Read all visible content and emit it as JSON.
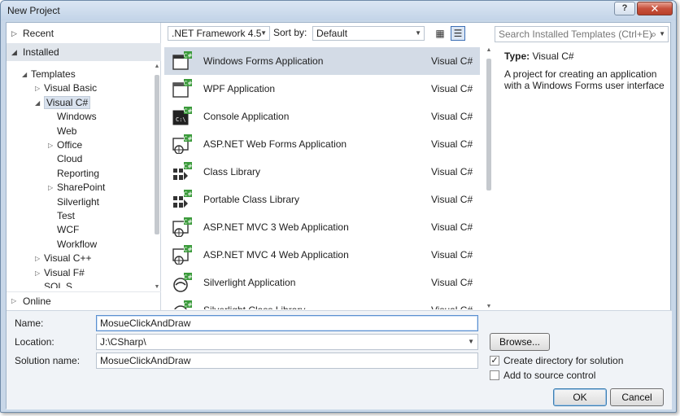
{
  "window": {
    "title": "New Project",
    "help": "?",
    "close": "✕"
  },
  "left_nav": {
    "recent": "Recent",
    "installed": "Installed",
    "online": "Online",
    "tree": [
      {
        "label": "Templates",
        "level": 0,
        "expand": "expanded"
      },
      {
        "label": "Visual Basic",
        "level": 1,
        "expand": "collapsed"
      },
      {
        "label": "Visual C#",
        "level": 1,
        "expand": "expanded",
        "selected": true
      },
      {
        "label": "Windows",
        "level": 2,
        "expand": "none"
      },
      {
        "label": "Web",
        "level": 2,
        "expand": "none"
      },
      {
        "label": "Office",
        "level": 2,
        "expand": "collapsed"
      },
      {
        "label": "Cloud",
        "level": 2,
        "expand": "none"
      },
      {
        "label": "Reporting",
        "level": 2,
        "expand": "none"
      },
      {
        "label": "SharePoint",
        "level": 2,
        "expand": "collapsed"
      },
      {
        "label": "Silverlight",
        "level": 2,
        "expand": "none"
      },
      {
        "label": "Test",
        "level": 2,
        "expand": "none"
      },
      {
        "label": "WCF",
        "level": 2,
        "expand": "none"
      },
      {
        "label": "Workflow",
        "level": 2,
        "expand": "none"
      },
      {
        "label": "Visual C++",
        "level": 1,
        "expand": "collapsed"
      },
      {
        "label": "Visual F#",
        "level": 1,
        "expand": "collapsed"
      },
      {
        "label": "SQL S",
        "level": 1,
        "expand": "none"
      }
    ]
  },
  "toolbar": {
    "framework": ".NET Framework 4.5",
    "sort_label": "Sort by:",
    "sort_value": "Default",
    "grid_view": "▦",
    "list_view": "☰"
  },
  "templates": [
    {
      "name": "Windows Forms Application",
      "lang": "Visual C#",
      "icon": "windows-forms-icon",
      "selected": true
    },
    {
      "name": "WPF Application",
      "lang": "Visual C#",
      "icon": "wpf-icon"
    },
    {
      "name": "Console Application",
      "lang": "Visual C#",
      "icon": "console-icon"
    },
    {
      "name": "ASP.NET Web Forms Application",
      "lang": "Visual C#",
      "icon": "web-forms-icon"
    },
    {
      "name": "Class Library",
      "lang": "Visual C#",
      "icon": "class-library-icon"
    },
    {
      "name": "Portable Class Library",
      "lang": "Visual C#",
      "icon": "portable-library-icon"
    },
    {
      "name": "ASP.NET MVC 3 Web Application",
      "lang": "Visual C#",
      "icon": "mvc3-icon"
    },
    {
      "name": "ASP.NET MVC 4 Web Application",
      "lang": "Visual C#",
      "icon": "mvc4-icon"
    },
    {
      "name": "Silverlight Application",
      "lang": "Visual C#",
      "icon": "silverlight-icon"
    },
    {
      "name": "Silverlight Class Library",
      "lang": "Visual C#",
      "icon": "silverlight-library-icon"
    }
  ],
  "details": {
    "search_placeholder": "Search Installed Templates (Ctrl+E)",
    "type_label": "Type:",
    "type_value": "Visual C#",
    "description": "A project for creating an application with a Windows Forms user interface"
  },
  "form": {
    "name_label": "Name:",
    "name_value": "MosueClickAndDraw",
    "location_label": "Location:",
    "location_value": "J:\\CSharp\\",
    "solution_label": "Solution name:",
    "solution_value": "MosueClickAndDraw",
    "browse": "Browse...",
    "create_dir": "Create directory for solution",
    "create_dir_checked": true,
    "source_control": "Add to source control",
    "source_control_checked": false,
    "ok": "OK",
    "cancel": "Cancel"
  },
  "colors": {
    "accent": "#3c7fb1",
    "selection": "#d3dbe6",
    "icon_green": "#3a9a3a"
  }
}
